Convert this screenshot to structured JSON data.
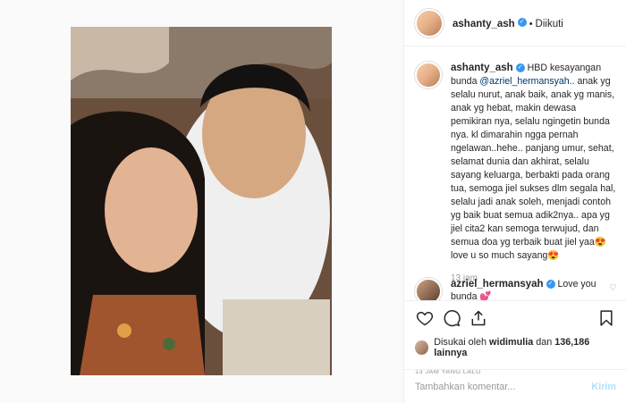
{
  "post": {
    "username": "ashanty_ash",
    "follow_label": "Diikuti",
    "caption_parts": {
      "lead": "HBD kesayangan bunda ",
      "mention": "@azriel_hermansyah",
      "text": ".. anak yg selalu nurut, anak baik, anak yg manis, anak yg hebat, makin dewasa pemikiran nya, selalu ngingetin bunda nya. kl dimarahin ngga pernah ngelawan..hehe.. panjang umur, sehat, selamat dunia dan akhirat, selalu sayang keluarga, berbakti pada orang tua, semoga jiel sukses dlm segala hal, selalu jadi anak soleh, menjadi contoh yg baik buat semua adik2nya.. apa yg jiel cita2 kan semoga terwujud, dan semua doa yg terbaik buat jiel yaa😍 love u so much sayang😍"
    },
    "caption_time": "13 jam",
    "comment": {
      "username": "azriel_hermansyah",
      "text": "Love you bunda 💕"
    },
    "likes": {
      "prefix": "Disukai oleh ",
      "user": "widimulia",
      "middle": " dan ",
      "count": "136,186",
      "suffix": " lainnya"
    },
    "time_ago": "13 JAM YANG LALU",
    "add_comment_placeholder": "Tambahkan komentar...",
    "post_button": "Kirim"
  },
  "colors": {
    "verified": "#3897f0",
    "mention": "#003569",
    "post_button": "#b2dffc"
  },
  "icons": [
    "verified-badge-icon",
    "heart-icon",
    "comment-icon",
    "share-icon",
    "bookmark-icon"
  ]
}
